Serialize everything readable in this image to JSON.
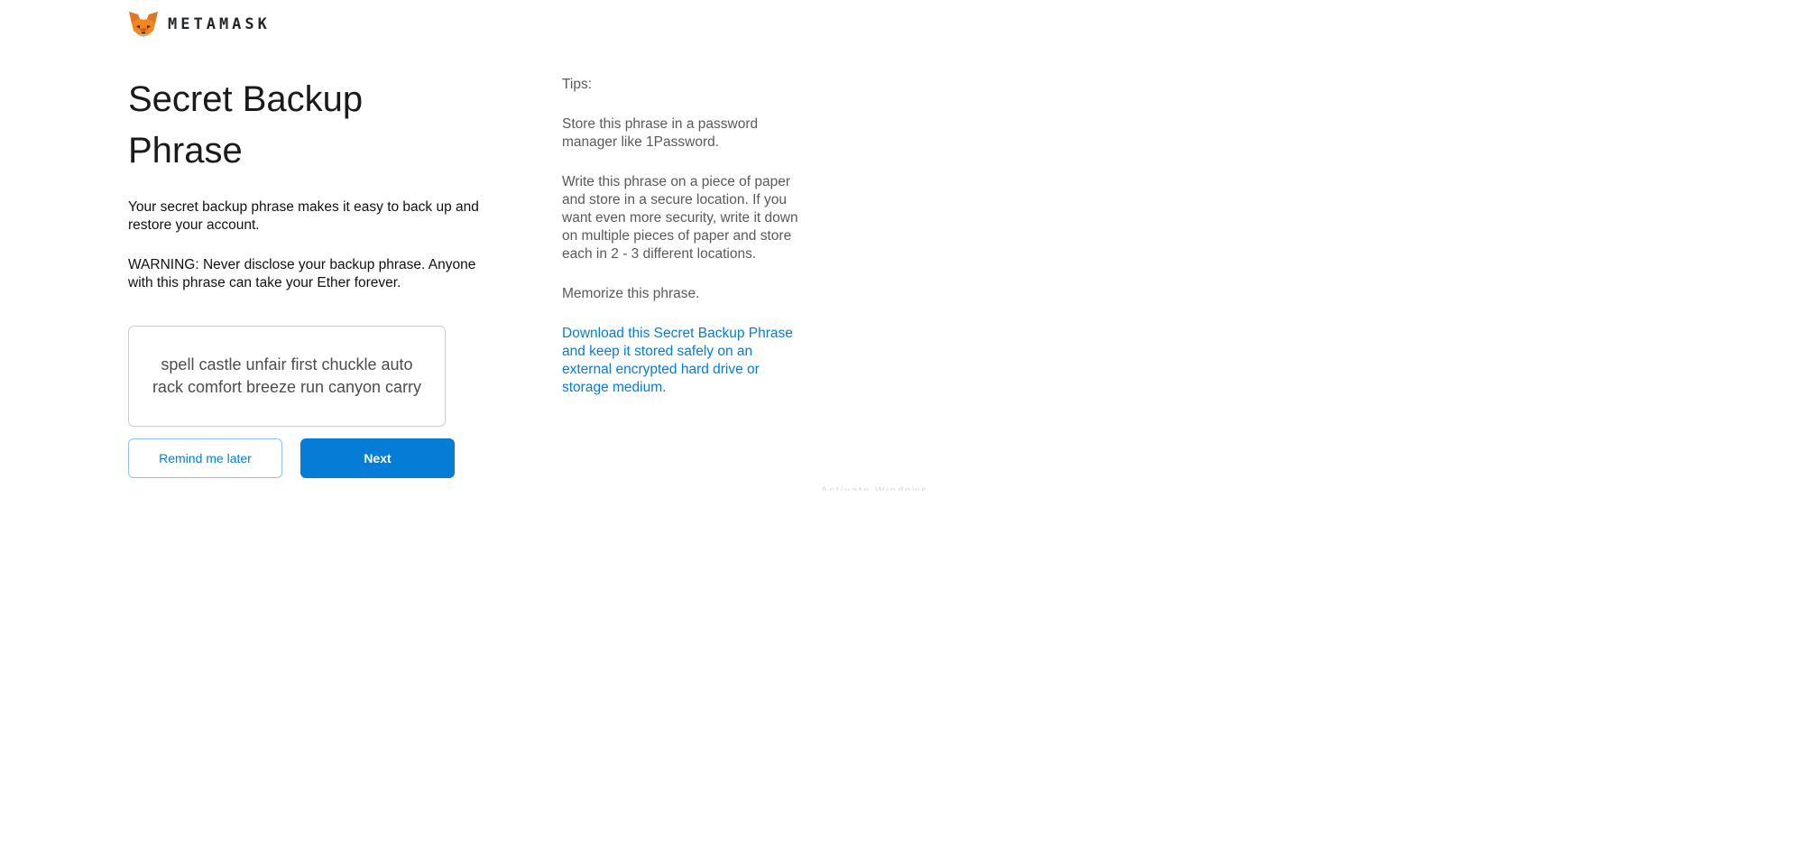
{
  "header": {
    "brand": "METAMASK",
    "logo_icon": "metamask-fox-icon"
  },
  "main": {
    "title": "Secret Backup Phrase",
    "description": "Your secret backup phrase makes it easy to back up and restore your account.",
    "warning": "WARNING: Never disclose your backup phrase. Anyone with this phrase can take your Ether forever.",
    "phrase": "spell castle unfair first chuckle auto rack comfort breeze run canyon carry",
    "buttons": {
      "remind_later": "Remind me later",
      "next": "Next"
    }
  },
  "tips": {
    "heading": "Tips:",
    "items": [
      "Store this phrase in a password manager like 1Password.",
      "Write this phrase on a piece of paper and store in a secure location. If you want even more security, write it down on multiple pieces of paper and store each in 2 - 3 different locations.",
      "Memorize this phrase."
    ],
    "download_link": "Download this Secret Backup Phrase and keep it stored safely on an external encrypted hard drive or storage medium",
    "download_suffix": "."
  },
  "colors": {
    "accent": "#037dd6",
    "fox_orange": "#e2761b",
    "text_muted": "#5a5a5a"
  }
}
